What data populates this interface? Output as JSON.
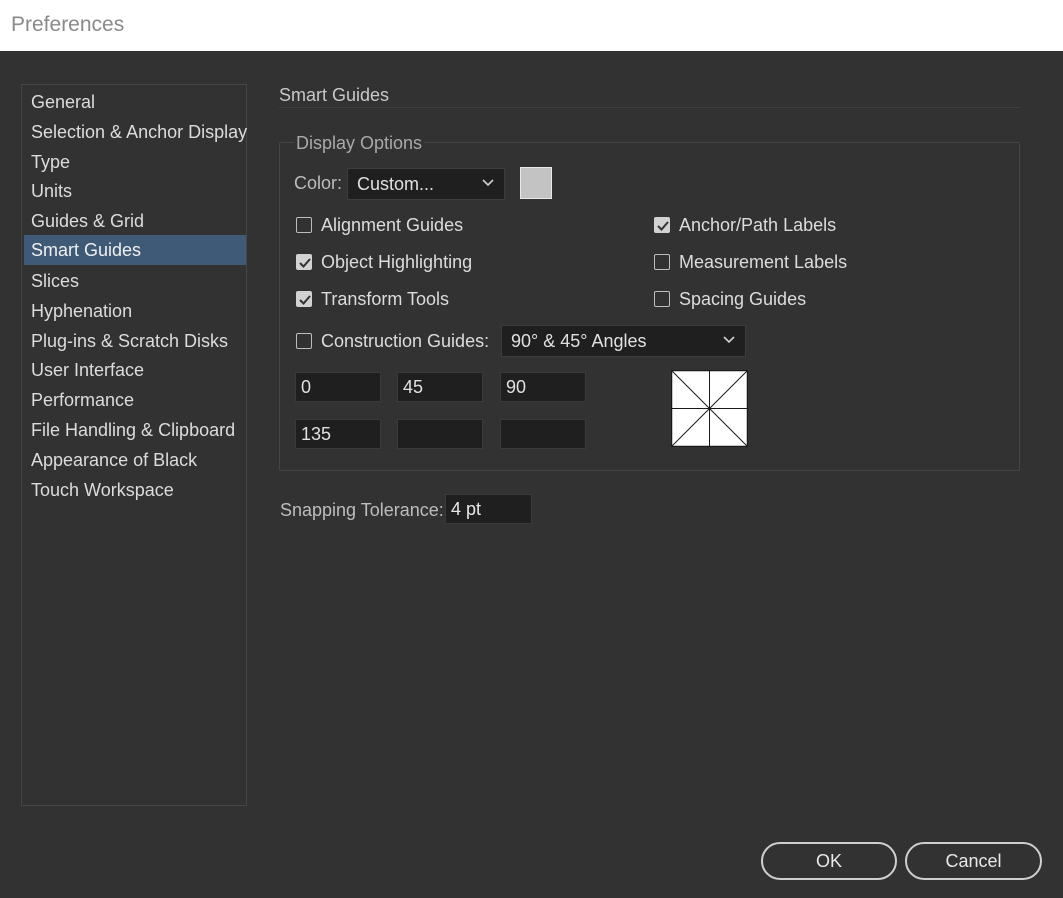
{
  "window": {
    "title": "Preferences"
  },
  "nav": {
    "items": [
      {
        "label": "General"
      },
      {
        "label": "Selection & Anchor Display"
      },
      {
        "label": "Type"
      },
      {
        "label": "Units"
      },
      {
        "label": "Guides & Grid"
      },
      {
        "label": "Smart Guides",
        "selected": true
      },
      {
        "label": "Slices"
      },
      {
        "label": "Hyphenation"
      },
      {
        "label": "Plug-ins & Scratch Disks"
      },
      {
        "label": "User Interface"
      },
      {
        "label": "Performance"
      },
      {
        "label": "File Handling & Clipboard"
      },
      {
        "label": "Appearance of Black"
      },
      {
        "label": "Touch Workspace"
      }
    ]
  },
  "panel": {
    "title": "Smart Guides",
    "display_options": {
      "label": "Display Options",
      "color_label": "Color:",
      "color_value": "Custom...",
      "swatch_color": "#c3c3c3",
      "checkboxes": {
        "alignment_guides": {
          "label": "Alignment Guides",
          "checked": false
        },
        "object_highlighting": {
          "label": "Object Highlighting",
          "checked": true
        },
        "transform_tools": {
          "label": "Transform Tools",
          "checked": true
        },
        "anchor_path_labels": {
          "label": "Anchor/Path Labels",
          "checked": true
        },
        "measurement_labels": {
          "label": "Measurement Labels",
          "checked": false
        },
        "spacing_guides": {
          "label": "Spacing Guides",
          "checked": false
        },
        "construction_guides": {
          "label": "Construction Guides:",
          "checked": false
        }
      },
      "construction_angles_value": "90° & 45° Angles",
      "angles": [
        "0",
        "45",
        "90",
        "135",
        "",
        ""
      ]
    },
    "snapping_tolerance": {
      "label": "Snapping Tolerance:",
      "value": "4 pt"
    }
  },
  "buttons": {
    "ok": "OK",
    "cancel": "Cancel"
  },
  "colors": {
    "selection": "#3e5a76",
    "background": "#323232",
    "field": "#1f1f1f"
  }
}
